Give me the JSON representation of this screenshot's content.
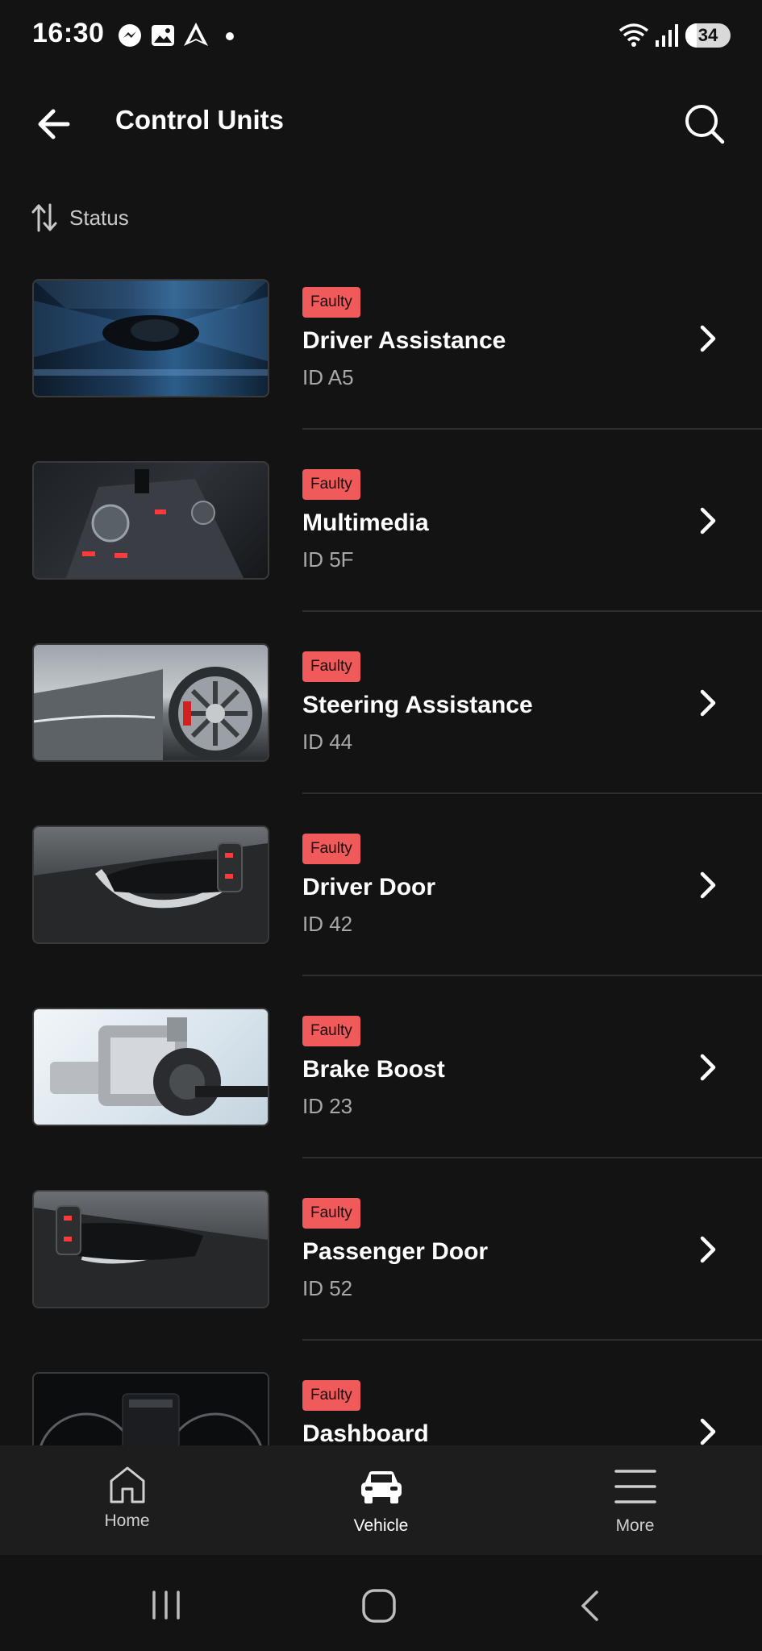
{
  "status_bar": {
    "time": "16:30",
    "battery": "34"
  },
  "header": {
    "title": "Control Units"
  },
  "sort": {
    "label": "Status"
  },
  "control_units": [
    {
      "status": "Faulty",
      "name": "Driver Assistance",
      "id": "ID A5",
      "thumb": "car-top-view"
    },
    {
      "status": "Faulty",
      "name": "Multimedia",
      "id": "ID 5F",
      "thumb": "console-knob"
    },
    {
      "status": "Faulty",
      "name": "Steering Assistance",
      "id": "ID 44",
      "thumb": "wheel"
    },
    {
      "status": "Faulty",
      "name": "Driver Door",
      "id": "ID 42",
      "thumb": "door-handle"
    },
    {
      "status": "Faulty",
      "name": "Brake Boost",
      "id": "ID 23",
      "thumb": "brake-booster"
    },
    {
      "status": "Faulty",
      "name": "Passenger Door",
      "id": "ID 52",
      "thumb": "door-handle-passenger"
    },
    {
      "status": "Faulty",
      "name": "Dashboard",
      "id": "",
      "thumb": "instrument-cluster"
    }
  ],
  "bottom_nav": [
    {
      "label": "Home",
      "icon": "home-icon",
      "active": false
    },
    {
      "label": "Vehicle",
      "icon": "car-icon",
      "active": true
    },
    {
      "label": "More",
      "icon": "menu-icon",
      "active": false
    }
  ],
  "colors": {
    "background": "#131313",
    "badge": "#f05a5a",
    "nav_background": "#1d1d1d"
  }
}
